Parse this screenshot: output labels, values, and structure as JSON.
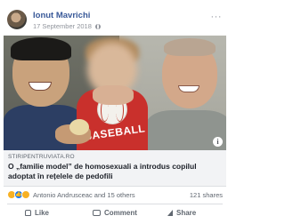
{
  "post": {
    "author": "Ionut Mavrichi",
    "date": "17 September 2018",
    "more_label": "···",
    "link": {
      "domain": "STIRIPENTRUVIATA.RO",
      "headline": "O „familie model” de homosexuali a introdus copilul adoptat în rețelele de pedofili",
      "shirt_text": "BASEBALL",
      "info_label": "i"
    },
    "reactions": {
      "types": [
        "haha",
        "like",
        "wow"
      ],
      "names": "Antonio Andrusceac and 15 others",
      "shares": "121 shares"
    },
    "actions": {
      "like": "Like",
      "comment": "Comment",
      "share": "Share"
    }
  },
  "colors": {
    "author_link": "#385898",
    "like_blue": "#1877f2",
    "caption_bg": "#f2f3f5"
  }
}
